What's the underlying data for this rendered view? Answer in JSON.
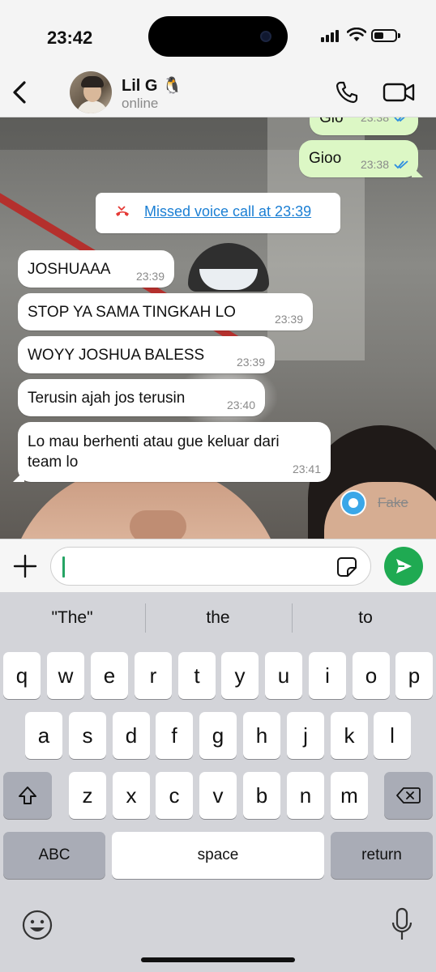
{
  "status_bar": {
    "time": "23:42",
    "battery_level": 0.45
  },
  "header": {
    "contact_name": "Lil G 🐧",
    "contact_status": "online",
    "icons": [
      "back-chevron-icon",
      "phone-icon",
      "video-camera-icon"
    ]
  },
  "chat": {
    "outgoing": [
      {
        "text": "Gio",
        "time": "23:38",
        "read": true
      },
      {
        "text": "Gioo",
        "time": "23:38",
        "read": true
      }
    ],
    "system": {
      "text": "Missed voice call at 23:39",
      "icon": "missed-call-icon"
    },
    "incoming": [
      {
        "text": "JOSHUAAA",
        "time": "23:39"
      },
      {
        "text": "STOP YA SAMA TINGKAH LO",
        "time": "23:39"
      },
      {
        "text": "WOYY JOSHUA BALESS",
        "time": "23:39"
      },
      {
        "text": "Terusin ajah jos terusin",
        "time": "23:40"
      },
      {
        "text": "Lo mau berhenti atau gue keluar dari team lo",
        "time": "23:41"
      }
    ],
    "watermark": "Fake"
  },
  "compose": {
    "placeholder": ""
  },
  "keyboard": {
    "suggestions": [
      "\"The\"",
      "the",
      "to"
    ],
    "row1": [
      "q",
      "w",
      "e",
      "r",
      "t",
      "y",
      "u",
      "i",
      "o",
      "p"
    ],
    "row2": [
      "a",
      "s",
      "d",
      "f",
      "g",
      "h",
      "j",
      "k",
      "l"
    ],
    "row3": [
      "z",
      "x",
      "c",
      "v",
      "b",
      "n",
      "m"
    ],
    "abc_label": "ABC",
    "space_label": "space",
    "return_label": "return"
  }
}
